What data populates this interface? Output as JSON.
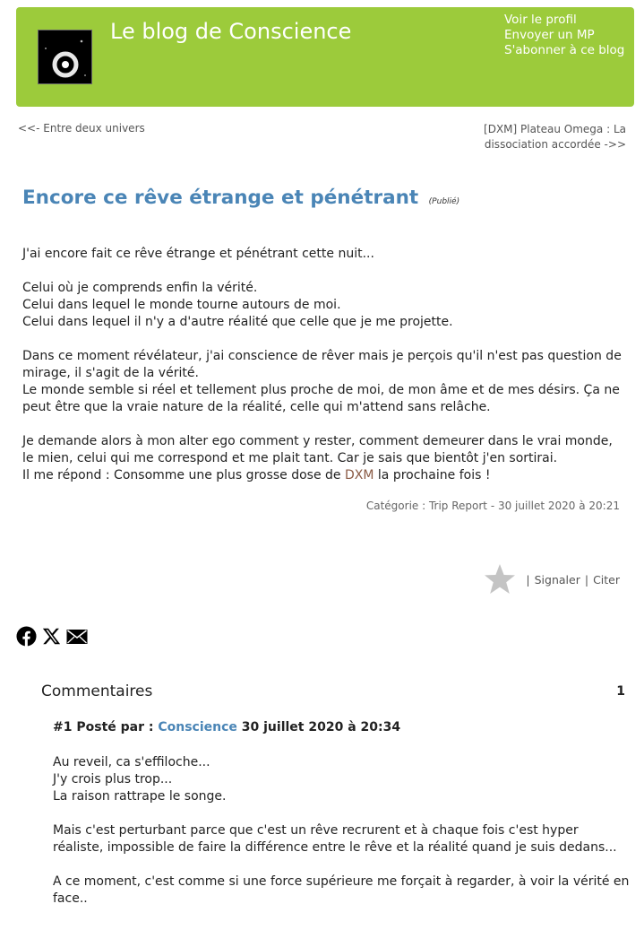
{
  "header": {
    "blog_title": "Le blog de Conscience",
    "links": [
      "Voir le profil",
      "Envoyer un MP",
      "S'abonner à ce blog"
    ],
    "bg_color": "#9ccb3b"
  },
  "nav": {
    "prev": "<<- Entre deux univers",
    "next_line1": "[DXM] Plateau Omega : La",
    "next_line2": "dissociation accordée ->>"
  },
  "post": {
    "title": "Encore ce rêve étrange et pénétrant",
    "status": "(Publié)",
    "paragraphs": [
      [
        "J'ai encore fait ce rêve étrange et pénétrant cette nuit..."
      ],
      [
        "Celui où je comprends enfin la vérité.",
        "Celui dans lequel le monde tourne autours de moi.",
        "Celui dans lequel il n'y a d'autre réalité que celle que je me projette."
      ],
      [
        "Dans ce moment révélateur, j'ai conscience de rêver mais je perçois qu'il n'est pas question de mirage, il s'agit de la vérité.",
        "Le monde semble si réel et tellement plus proche de moi, de mon âme et de mes désirs. Ça ne peut être que la vraie nature de la réalité, celle qui m'attend sans relâche."
      ],
      [
        "Je demande alors à mon alter ego comment y rester, comment demeurer dans le vrai monde, le mien, celui qui me correspond et me plait tant. Car je sais que bientôt j'en sortirai."
      ]
    ],
    "last_line_before": "Il me répond : Consomme une plus grosse dose de ",
    "last_line_link": "DXM",
    "last_line_after": " la prochaine fois !",
    "meta": "Catégorie : Trip Report - 30 juillet 2020 à  20:21"
  },
  "actions": {
    "star_icon": "star-icon",
    "report": "Signaler",
    "quote": "Citer",
    "separator": "|"
  },
  "share": {
    "icons": [
      "facebook-icon",
      "x-icon",
      "mail-icon"
    ]
  },
  "comments": {
    "title": "Commentaires",
    "count": "1",
    "items": [
      {
        "number": "#1",
        "posted_by": "Posté par :",
        "author": "Conscience",
        "date": "30 juillet 2020 à  20:34",
        "paragraphs": [
          [
            "Au reveil, ca s'effiloche...",
            "J'y crois plus trop...",
            "La raison rattrape le songe."
          ],
          [
            "Mais c'est perturbant parce que c'est un rêve recrurent et à chaque fois c'est hyper réaliste, impossible de faire la différence entre le rêve et la réalité quand je suis dedans..."
          ],
          [
            "A ce moment, c'est comme si une force supérieure me forçait à regarder, à voir la vérité en face.."
          ]
        ]
      }
    ]
  }
}
